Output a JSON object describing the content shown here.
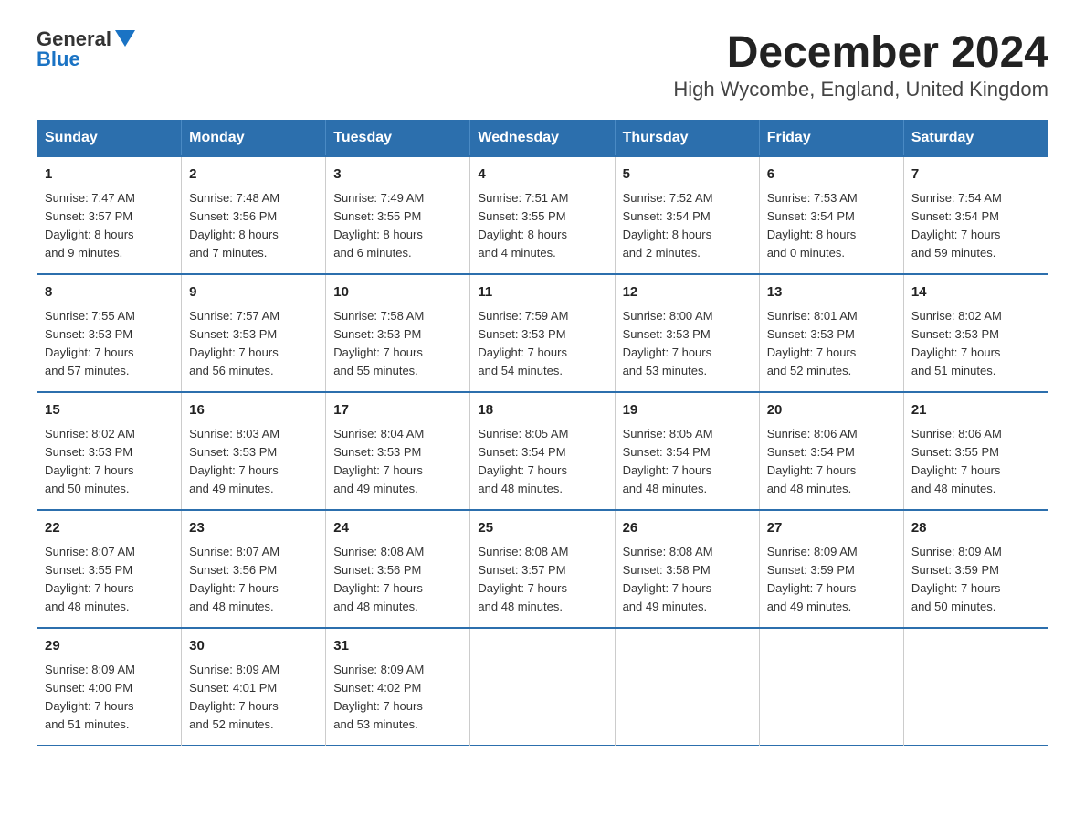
{
  "header": {
    "logo_general": "General",
    "logo_blue": "Blue",
    "title": "December 2024",
    "subtitle": "High Wycombe, England, United Kingdom"
  },
  "calendar": {
    "days_of_week": [
      "Sunday",
      "Monday",
      "Tuesday",
      "Wednesday",
      "Thursday",
      "Friday",
      "Saturday"
    ],
    "weeks": [
      [
        {
          "day": "1",
          "sunrise": "7:47 AM",
          "sunset": "3:57 PM",
          "daylight": "8 hours and 9 minutes."
        },
        {
          "day": "2",
          "sunrise": "7:48 AM",
          "sunset": "3:56 PM",
          "daylight": "8 hours and 7 minutes."
        },
        {
          "day": "3",
          "sunrise": "7:49 AM",
          "sunset": "3:55 PM",
          "daylight": "8 hours and 6 minutes."
        },
        {
          "day": "4",
          "sunrise": "7:51 AM",
          "sunset": "3:55 PM",
          "daylight": "8 hours and 4 minutes."
        },
        {
          "day": "5",
          "sunrise": "7:52 AM",
          "sunset": "3:54 PM",
          "daylight": "8 hours and 2 minutes."
        },
        {
          "day": "6",
          "sunrise": "7:53 AM",
          "sunset": "3:54 PM",
          "daylight": "8 hours and 0 minutes."
        },
        {
          "day": "7",
          "sunrise": "7:54 AM",
          "sunset": "3:54 PM",
          "daylight": "7 hours and 59 minutes."
        }
      ],
      [
        {
          "day": "8",
          "sunrise": "7:55 AM",
          "sunset": "3:53 PM",
          "daylight": "7 hours and 57 minutes."
        },
        {
          "day": "9",
          "sunrise": "7:57 AM",
          "sunset": "3:53 PM",
          "daylight": "7 hours and 56 minutes."
        },
        {
          "day": "10",
          "sunrise": "7:58 AM",
          "sunset": "3:53 PM",
          "daylight": "7 hours and 55 minutes."
        },
        {
          "day": "11",
          "sunrise": "7:59 AM",
          "sunset": "3:53 PM",
          "daylight": "7 hours and 54 minutes."
        },
        {
          "day": "12",
          "sunrise": "8:00 AM",
          "sunset": "3:53 PM",
          "daylight": "7 hours and 53 minutes."
        },
        {
          "day": "13",
          "sunrise": "8:01 AM",
          "sunset": "3:53 PM",
          "daylight": "7 hours and 52 minutes."
        },
        {
          "day": "14",
          "sunrise": "8:02 AM",
          "sunset": "3:53 PM",
          "daylight": "7 hours and 51 minutes."
        }
      ],
      [
        {
          "day": "15",
          "sunrise": "8:02 AM",
          "sunset": "3:53 PM",
          "daylight": "7 hours and 50 minutes."
        },
        {
          "day": "16",
          "sunrise": "8:03 AM",
          "sunset": "3:53 PM",
          "daylight": "7 hours and 49 minutes."
        },
        {
          "day": "17",
          "sunrise": "8:04 AM",
          "sunset": "3:53 PM",
          "daylight": "7 hours and 49 minutes."
        },
        {
          "day": "18",
          "sunrise": "8:05 AM",
          "sunset": "3:54 PM",
          "daylight": "7 hours and 48 minutes."
        },
        {
          "day": "19",
          "sunrise": "8:05 AM",
          "sunset": "3:54 PM",
          "daylight": "7 hours and 48 minutes."
        },
        {
          "day": "20",
          "sunrise": "8:06 AM",
          "sunset": "3:54 PM",
          "daylight": "7 hours and 48 minutes."
        },
        {
          "day": "21",
          "sunrise": "8:06 AM",
          "sunset": "3:55 PM",
          "daylight": "7 hours and 48 minutes."
        }
      ],
      [
        {
          "day": "22",
          "sunrise": "8:07 AM",
          "sunset": "3:55 PM",
          "daylight": "7 hours and 48 minutes."
        },
        {
          "day": "23",
          "sunrise": "8:07 AM",
          "sunset": "3:56 PM",
          "daylight": "7 hours and 48 minutes."
        },
        {
          "day": "24",
          "sunrise": "8:08 AM",
          "sunset": "3:56 PM",
          "daylight": "7 hours and 48 minutes."
        },
        {
          "day": "25",
          "sunrise": "8:08 AM",
          "sunset": "3:57 PM",
          "daylight": "7 hours and 48 minutes."
        },
        {
          "day": "26",
          "sunrise": "8:08 AM",
          "sunset": "3:58 PM",
          "daylight": "7 hours and 49 minutes."
        },
        {
          "day": "27",
          "sunrise": "8:09 AM",
          "sunset": "3:59 PM",
          "daylight": "7 hours and 49 minutes."
        },
        {
          "day": "28",
          "sunrise": "8:09 AM",
          "sunset": "3:59 PM",
          "daylight": "7 hours and 50 minutes."
        }
      ],
      [
        {
          "day": "29",
          "sunrise": "8:09 AM",
          "sunset": "4:00 PM",
          "daylight": "7 hours and 51 minutes."
        },
        {
          "day": "30",
          "sunrise": "8:09 AM",
          "sunset": "4:01 PM",
          "daylight": "7 hours and 52 minutes."
        },
        {
          "day": "31",
          "sunrise": "8:09 AM",
          "sunset": "4:02 PM",
          "daylight": "7 hours and 53 minutes."
        },
        null,
        null,
        null,
        null
      ]
    ],
    "labels": {
      "sunrise": "Sunrise:",
      "sunset": "Sunset:",
      "daylight": "Daylight:"
    }
  }
}
